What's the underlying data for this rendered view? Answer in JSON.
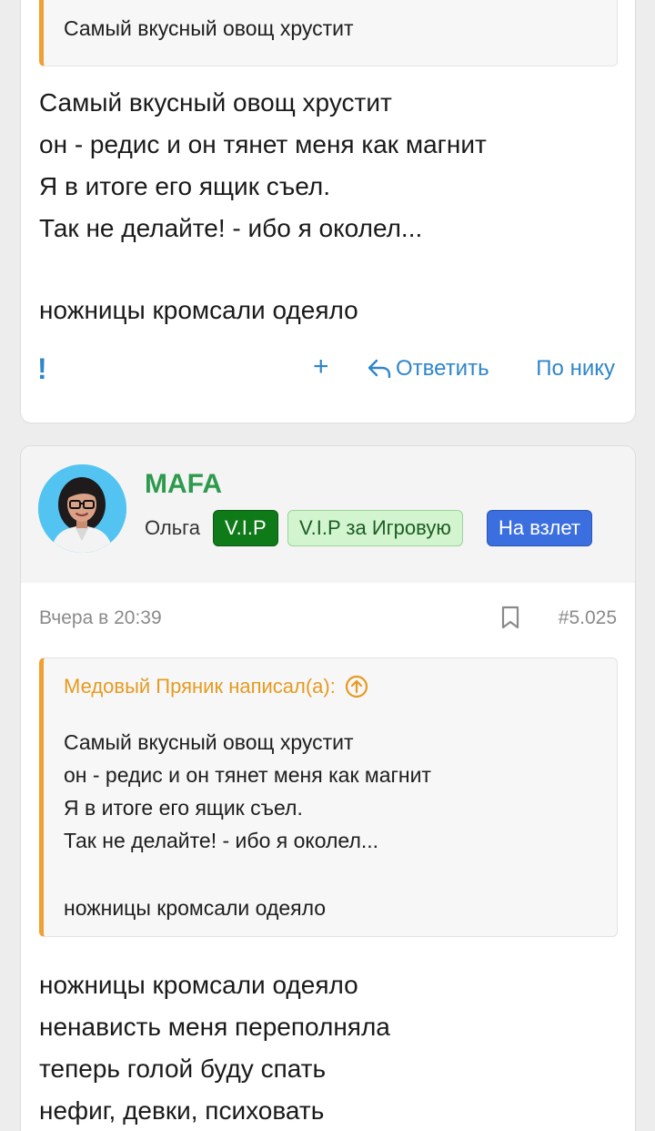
{
  "post1": {
    "quote_text": "Самый вкусный овощ хрустит",
    "message_lines": [
      "Самый вкусный овощ хрустит",
      "он - редис и он тянет меня как магнит",
      "Я в итоге его ящик съел.",
      "Так не делайте! - ибо я околел...",
      "",
      "ножницы кромсали одеяло"
    ],
    "actions": {
      "report": "!",
      "add": "+",
      "reply": "Ответить",
      "by_nick": "По нику"
    }
  },
  "post2": {
    "username": "MAFA",
    "user_title": "Ольга",
    "badges": [
      "V.I.P",
      "V.I.P за Игровую",
      "На взлет"
    ],
    "date": "Вчера в 20:39",
    "post_number": "#5.025",
    "quote": {
      "author": "Медовый Пряник написал(а):",
      "lines": [
        "Самый вкусный овощ хрустит",
        "он - редис и он тянет меня как магнит",
        "Я в итоге его ящик съел.",
        "Так не делайте! - ибо я околел...",
        "",
        "ножницы кромсали одеяло"
      ]
    },
    "message_lines": [
      "ножницы кромсали одеяло",
      "ненависть меня переполняла",
      "теперь голой буду спать",
      "нефиг, девки, психовать"
    ]
  },
  "colors": {
    "link": "#2f86c8",
    "username": "#2e9a4d",
    "quote_accent": "#f0a030",
    "quote_author": "#e59b22",
    "badge_vip": "#0f7a18",
    "badge_game": "#d2f5cf",
    "badge_fly": "#3b6fe0"
  },
  "icons": {
    "reply": "reply-arrow-icon",
    "bookmark": "bookmark-icon",
    "quote_jump": "arrow-up-circle-icon",
    "avatar": "user-avatar"
  }
}
